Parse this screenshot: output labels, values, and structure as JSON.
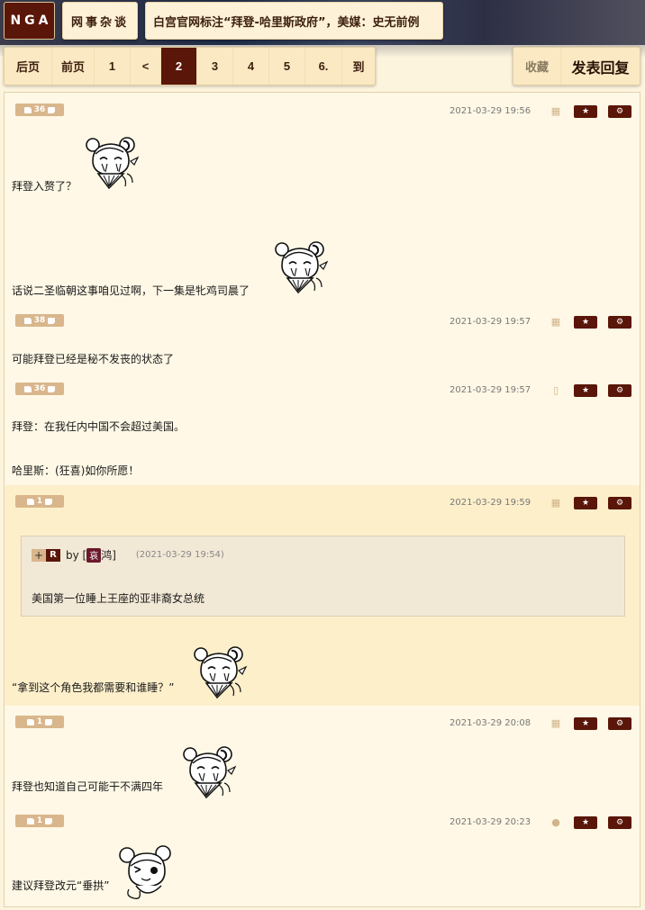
{
  "header": {
    "logo": "NGA",
    "forum": "网事杂谈",
    "thread_title": "白宫官网标注“拜登-哈里斯政府”，美媒：史无前例"
  },
  "pager": {
    "items": [
      "后页",
      "前页",
      "1",
      "<",
      "2",
      "3",
      "4",
      "5",
      "6.",
      "到"
    ],
    "current": "2"
  },
  "actions": {
    "favorite": "收藏",
    "reply": "发表回复"
  },
  "posts": [
    {
      "likes": "36",
      "time": "2021-03-29 19:56",
      "device": "android-icon",
      "lines": [
        "拜登入赘了？",
        "话说二圣临朝这事咱见过啊，下一集是牝鸡司晨了"
      ]
    },
    {
      "likes": "38",
      "time": "2021-03-29 19:57",
      "device": "android-icon",
      "lines": [
        "可能拜登已经是秘不发丧的状态了"
      ]
    },
    {
      "likes": "36",
      "time": "2021-03-29 19:57",
      "device": "mobile-icon",
      "lines": [
        "拜登：在我任内中国不会超过美国。",
        "哈里斯：(狂喜)如你所愿！"
      ]
    },
    {
      "likes": "1",
      "time": "2021-03-29 19:59",
      "device": "android-icon",
      "quote": {
        "plus": "+",
        "badge": "R",
        "by": "by [",
        "avatar_char": "哀",
        "author": "鸿]",
        "time": "(2021-03-29 19:54)",
        "text": "美国第一位睡上王座的亚非裔女总统"
      },
      "lines": [
        "“拿到这个角色我都需要和谁睡？”"
      ]
    },
    {
      "likes": "1",
      "time": "2021-03-29 20:08",
      "device": "android-icon",
      "lines": [
        "拜登也知道自己可能干不满四年"
      ]
    },
    {
      "likes": "1",
      "time": "2021-03-29 20:23",
      "device": "apple-icon",
      "lines": [
        "建议拜登改元“垂拱”"
      ]
    }
  ],
  "colors": {
    "brand": "#5a1608",
    "page_bg": "#fdf4de",
    "post_bg": "#fff8e6",
    "alt_post_bg": "#fdefca",
    "like_badge": "#d9b68c"
  }
}
